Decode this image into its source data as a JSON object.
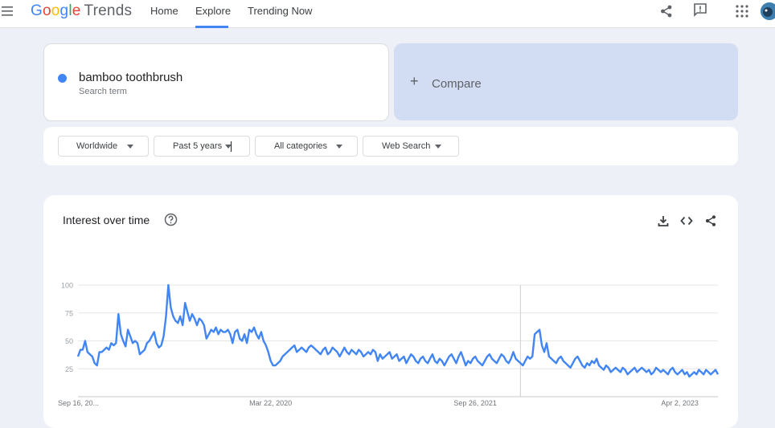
{
  "header": {
    "logo_google": "Google",
    "logo_trends": "Trends",
    "nav": [
      {
        "label": "Home"
      },
      {
        "label": "Explore"
      },
      {
        "label": "Trending Now"
      }
    ],
    "icons": [
      "menu-icon",
      "share-icon",
      "feedback-icon",
      "apps-icon",
      "avatar"
    ]
  },
  "search": {
    "term": "bamboo toothbrush",
    "term_type": "Search term",
    "term_color": "#4285f4",
    "compare_plus": "+",
    "compare_label": "Compare"
  },
  "filters": [
    {
      "label": "Worldwide"
    },
    {
      "label": "Past 5 years"
    },
    {
      "label": "All categories"
    },
    {
      "label": "Web Search"
    }
  ],
  "interest_card": {
    "title": "Interest over time",
    "actions": [
      "download-icon",
      "embed-icon",
      "share-icon"
    ]
  },
  "chart_data": {
    "type": "line",
    "y_ticks": [
      100,
      75,
      50,
      25
    ],
    "ylim": [
      0,
      100
    ],
    "x_tick_labels": [
      "Sep 16, 20...",
      "Mar 22, 2020",
      "Sep 26, 2021",
      "Apr 2, 2023"
    ],
    "x_tick_index": [
      0,
      81,
      167,
      253
    ],
    "partial_data_start_index": 186,
    "line_color": "#4285f4",
    "grid": true,
    "series": [
      {
        "values": [
          36,
          42,
          42,
          50,
          40,
          38,
          36,
          30,
          28,
          40,
          40,
          42,
          44,
          42,
          48,
          46,
          48,
          74,
          56,
          50,
          45,
          60,
          54,
          48,
          50,
          48,
          38,
          40,
          42,
          48,
          50,
          54,
          58,
          48,
          44,
          46,
          54,
          72,
          100,
          80,
          72,
          68,
          66,
          72,
          64,
          84,
          76,
          68,
          74,
          70,
          64,
          70,
          68,
          64,
          52,
          56,
          60,
          58,
          62,
          56,
          60,
          58,
          58,
          60,
          56,
          48,
          58,
          60,
          52,
          50,
          56,
          48,
          60,
          58,
          62,
          56,
          52,
          58,
          50,
          46,
          40,
          32,
          28,
          28,
          30,
          32,
          36,
          38,
          40,
          42,
          44,
          46,
          40,
          42,
          44,
          42,
          40,
          44,
          46,
          44,
          42,
          40,
          38,
          42,
          44,
          38,
          40,
          44,
          42,
          40,
          36,
          40,
          44,
          40,
          38,
          42,
          40,
          38,
          42,
          40,
          36,
          38,
          40,
          38,
          42,
          40,
          32,
          38,
          34,
          36,
          38,
          40,
          34,
          36,
          38,
          32,
          34,
          36,
          30,
          34,
          38,
          36,
          32,
          30,
          34,
          36,
          32,
          30,
          34,
          38,
          32,
          30,
          34,
          32,
          28,
          32,
          36,
          38,
          34,
          30,
          36,
          40,
          34,
          28,
          32,
          30,
          34,
          36,
          32,
          30,
          28,
          32,
          36,
          38,
          34,
          32,
          30,
          34,
          38,
          36,
          32,
          30,
          34,
          40,
          34,
          32,
          30,
          28,
          32,
          36,
          34,
          36,
          56,
          58,
          60,
          46,
          40,
          48,
          36,
          34,
          32,
          30,
          34,
          36,
          32,
          30,
          28,
          26,
          30,
          34,
          36,
          32,
          28,
          26,
          30,
          28,
          32,
          30,
          34,
          28,
          26,
          24,
          28,
          26,
          22,
          24,
          26,
          24,
          22,
          26,
          24,
          20,
          22,
          24,
          26,
          22,
          24,
          26,
          24,
          22,
          24,
          20,
          22,
          26,
          24,
          22,
          24,
          22,
          20,
          24,
          26,
          22,
          20,
          22,
          24,
          20,
          22,
          18,
          20,
          22,
          20,
          24,
          22,
          20,
          24,
          22,
          20,
          22,
          24,
          20
        ]
      }
    ]
  }
}
